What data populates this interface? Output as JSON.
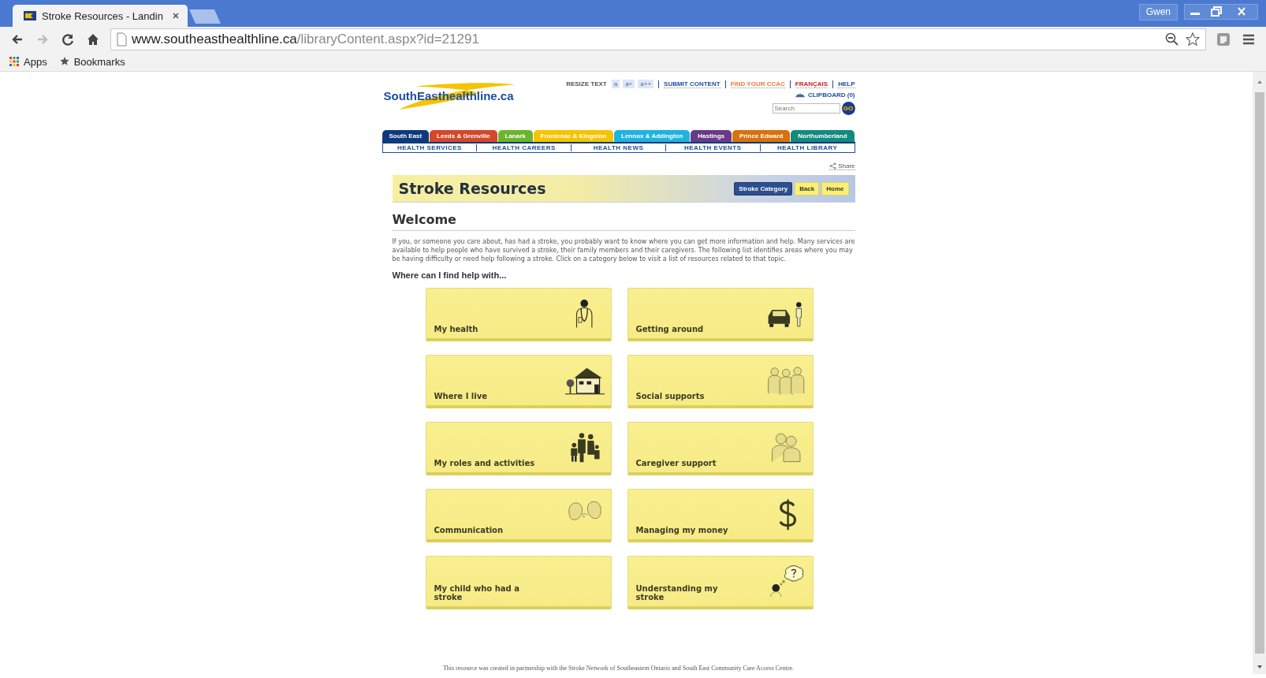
{
  "browser": {
    "tab_title": "Stroke Resources - Landin",
    "profile": "Gwen",
    "url_host": "www.southeasthealthline.ca",
    "url_path": "/libraryContent.aspx?id=21291",
    "bookmarks": [
      {
        "label": "Apps",
        "kind": "apps"
      },
      {
        "label": "Bookmarks",
        "kind": "star"
      }
    ]
  },
  "site": {
    "logo": "SouthEast**healthline**.ca",
    "resize_label": "RESIZE TEXT",
    "resize_buttons": [
      "a",
      "a+",
      "a++"
    ],
    "top_links": [
      {
        "label": "SUBMIT CONTENT",
        "color": "#1f4ea0"
      },
      {
        "label": "FIND YOUR CCAC",
        "color": "#f07a3a"
      },
      {
        "label": "FRANÇAIS",
        "color": "#d02020"
      },
      {
        "label": "HELP",
        "color": "#1f4ea0"
      }
    ],
    "clipboard": "CLIPBOARD (0)",
    "search": {
      "placeholder": "Search",
      "button": "GO"
    },
    "regions": [
      {
        "label": "South East",
        "color": "#0d3a7a"
      },
      {
        "label": "Leeds & Grenville",
        "color": "#d4472a"
      },
      {
        "label": "Lanark",
        "color": "#6cb52e"
      },
      {
        "label": "Frontenac & Kingston",
        "color": "#f5c400"
      },
      {
        "label": "Lennox & Addington",
        "color": "#1fb3e0"
      },
      {
        "label": "Hastings",
        "color": "#6a3a88"
      },
      {
        "label": "Prince Edward",
        "color": "#d8720c"
      },
      {
        "label": "Northumberland",
        "color": "#128a80"
      }
    ],
    "nav": [
      "HEALTH SERVICES",
      "HEALTH CAREERS",
      "HEALTH NEWS",
      "HEALTH EVENTS",
      "HEALTH LIBRARY"
    ],
    "share": "Share",
    "page_title": "Stroke Resources",
    "title_buttons": [
      {
        "label": "Stroke Category",
        "selected": true
      },
      {
        "label": "Back",
        "selected": false
      },
      {
        "label": "Home",
        "selected": false
      }
    ],
    "heading": "Welcome",
    "intro": "If you, or someone you care about, has had a stroke, you probably want to know where you can get more information and help. Many services are available to help people who have survived a stroke, their family members and their caregivers. The following list identifies areas where you may be having difficulty or need help following a stroke. Click on a category below to visit a list of resources related to that topic.",
    "subheading": "Where can I find help with...",
    "cards": [
      {
        "label": "My health"
      },
      {
        "label": "Getting around"
      },
      {
        "label": "Where I live"
      },
      {
        "label": "Social supports"
      },
      {
        "label": "My roles and activities"
      },
      {
        "label": "Caregiver support"
      },
      {
        "label": "Communication"
      },
      {
        "label": "Managing my money"
      },
      {
        "label": "My child who had a stroke"
      },
      {
        "label": "Understanding my stroke"
      }
    ],
    "footer": "This resource was created in partnership with the Stroke Network of Southeastern Ontario and South East Community Care Access Centre."
  }
}
